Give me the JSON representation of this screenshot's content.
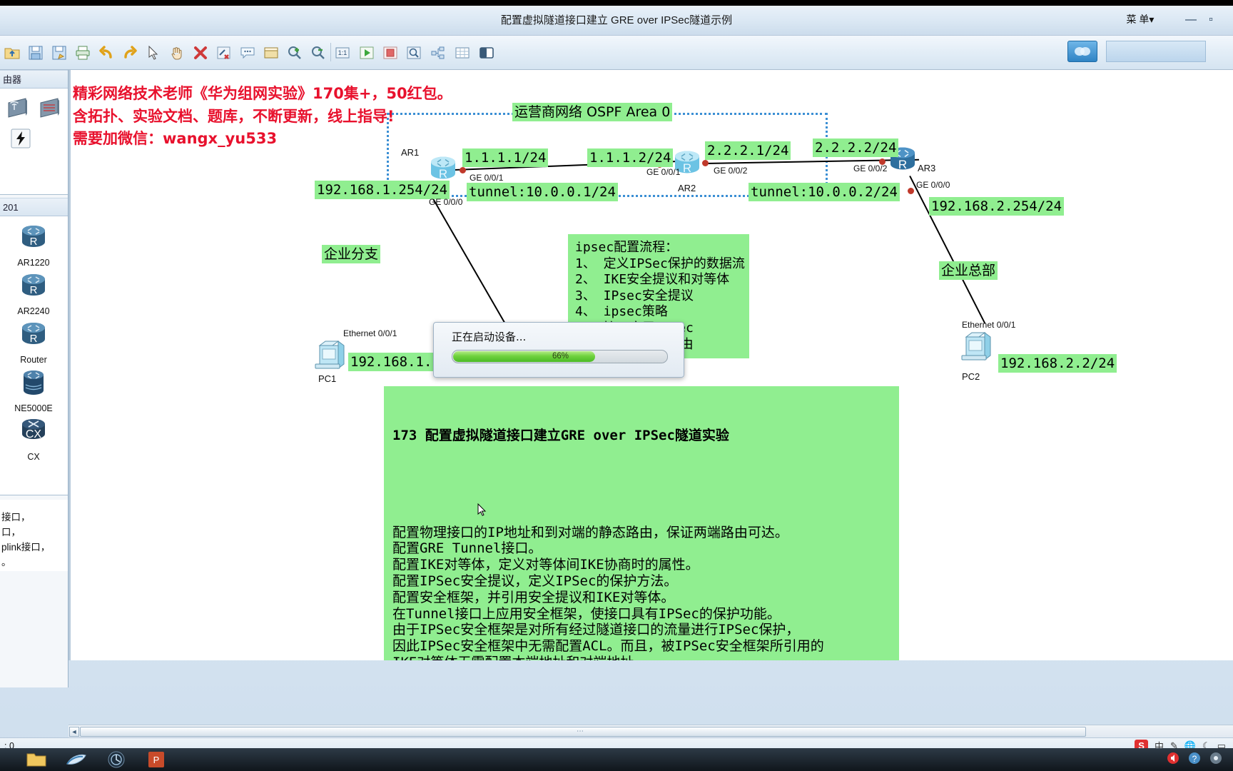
{
  "window": {
    "title": "配置虚拟隧道接口建立 GRE over IPSec隧道示例",
    "menu_label": "菜 单",
    "minimize": "—",
    "maximize": "▫"
  },
  "toolbar": {
    "buttons": [
      {
        "name": "open-icon",
        "label": "📂"
      },
      {
        "name": "save-icon",
        "label": "💾"
      },
      {
        "name": "save-as-icon",
        "label": "💾"
      },
      {
        "name": "print-icon",
        "label": "🖨"
      },
      {
        "name": "undo-icon",
        "label": "↶"
      },
      {
        "name": "redo-icon",
        "label": "↷"
      },
      {
        "name": "select-pointer-icon",
        "label": "↖"
      },
      {
        "name": "pan-hand-icon",
        "label": "✋"
      },
      {
        "name": "delete-icon",
        "label": "✖"
      },
      {
        "name": "delete-link-icon",
        "label": "🔗"
      },
      {
        "name": "note-icon",
        "label": "💬"
      },
      {
        "name": "text-box-icon",
        "label": "▭"
      },
      {
        "name": "zoom-in-icon",
        "label": "🔍"
      },
      {
        "name": "zoom-out-icon",
        "label": "🔍"
      },
      {
        "name": "zoom-reset-icon",
        "label": "1:1"
      },
      {
        "name": "start-all-icon",
        "label": "▶"
      },
      {
        "name": "stop-all-icon",
        "label": "■"
      },
      {
        "name": "capture-icon",
        "label": "🔎"
      },
      {
        "name": "topology-tree-icon",
        "label": "⊟"
      },
      {
        "name": "grid-icon",
        "label": "▦"
      },
      {
        "name": "cloud-icon",
        "label": "◧"
      }
    ]
  },
  "left_panel": {
    "section1_header": "由器",
    "section1_devices": [
      {
        "name": "wireless-ap-device",
        "label": ""
      },
      {
        "name": "lan-switch-device",
        "label": ""
      },
      {
        "name": "power-device",
        "label": ""
      }
    ],
    "section2_header": "201",
    "devices": [
      {
        "label": "AR1220"
      },
      {
        "label": "AR2240"
      },
      {
        "label": "Router"
      },
      {
        "label": "NE5000E"
      },
      {
        "label": "CX"
      }
    ],
    "description_lines": [
      "接口，",
      "口，",
      "plink接口，",
      "。"
    ]
  },
  "annotation": {
    "line1": "精彩网络技术老师《华为组网实验》170集+，50红包。",
    "line2": "含拓扑、实验文档、题库，不断更新，线上指导!",
    "line3": "需要加微信：wangx_yu533"
  },
  "topology": {
    "ospf_label": "运营商网络 OSPF Area 0",
    "branch_label": "企业分支",
    "hq_label": "企业总部",
    "routers": [
      {
        "name": "AR1"
      },
      {
        "name": "AR2"
      },
      {
        "name": "AR3"
      }
    ],
    "pcs": [
      {
        "name": "PC1"
      },
      {
        "name": "PC2"
      }
    ],
    "ip_labels": [
      {
        "text": "1.1.1.1/24"
      },
      {
        "text": "1.1.1.2/24"
      },
      {
        "text": "2.2.2.1/24"
      },
      {
        "text": "2.2.2.2/24"
      },
      {
        "text": "192.168.1.254/24"
      },
      {
        "text": "192.168.2.254/24"
      },
      {
        "text": "192.168.1.1/"
      },
      {
        "text": "192.168.2.2/24"
      },
      {
        "text": "tunnel:10.0.0.1/24"
      },
      {
        "text": "tunnel:10.0.0.2/24"
      }
    ],
    "port_labels": [
      {
        "text": "GE 0/0/1"
      },
      {
        "text": "GE 0/0/1"
      },
      {
        "text": "GE 0/0/2"
      },
      {
        "text": "GE 0/0/2"
      },
      {
        "text": "GE 0/0/0"
      },
      {
        "text": "GE 0/0/0"
      },
      {
        "text": "Ethernet 0/0/1"
      },
      {
        "text": "Ethernet 0/0/1"
      }
    ]
  },
  "ipsec_box": {
    "text": "ipsec配置流程：\n1、 定义IPSec保护的数据流\n2、 IKE安全提议和对等体\n3、 IPsec安全提议\n4、 ipsec策略\n5、 接口应用IPsec\n6、 配置引流的路由"
  },
  "dialog": {
    "title": "正在启动设备...",
    "progress_percent": 66,
    "progress_text": "66%"
  },
  "description_box": {
    "title": "173 配置虚拟隧道接口建立GRE over IPSec隧道实验",
    "body": "配置物理接口的IP地址和到对端的静态路由，保证两端路由可达。\n配置GRE Tunnel接口。\n配置IKE对等体，定义对等体间IKE协商时的属性。\n配置IPSec安全提议，定义IPSec的保护方法。\n配置安全框架，并引用安全提议和IKE对等体。\n在Tunnel接口上应用安全框架，使接口具有IPSec的保护功能。\n由于IPSec安全框架是对所有经过隧道接口的流量进行IPSec保护，\n因此IPSec安全框架中无需配置ACL。而且，被IPSec安全框架所引用的\nIKE对等体无需配置本端地址和对端地址。\n配置Tunnel接口的转发路由，将需要IPSec保护的数据流引到Tunnel接口。"
  },
  "statusbar": {
    "text": ": 0"
  },
  "tray": {
    "items": [
      "S",
      "中",
      "✎",
      "🌐",
      "☾",
      "▭"
    ]
  },
  "colors": {
    "highlight_green": "#90ee90",
    "annotation_red": "#e8112d",
    "ospf_dash": "#3b8fd4",
    "progress_green": "#4cba25"
  }
}
